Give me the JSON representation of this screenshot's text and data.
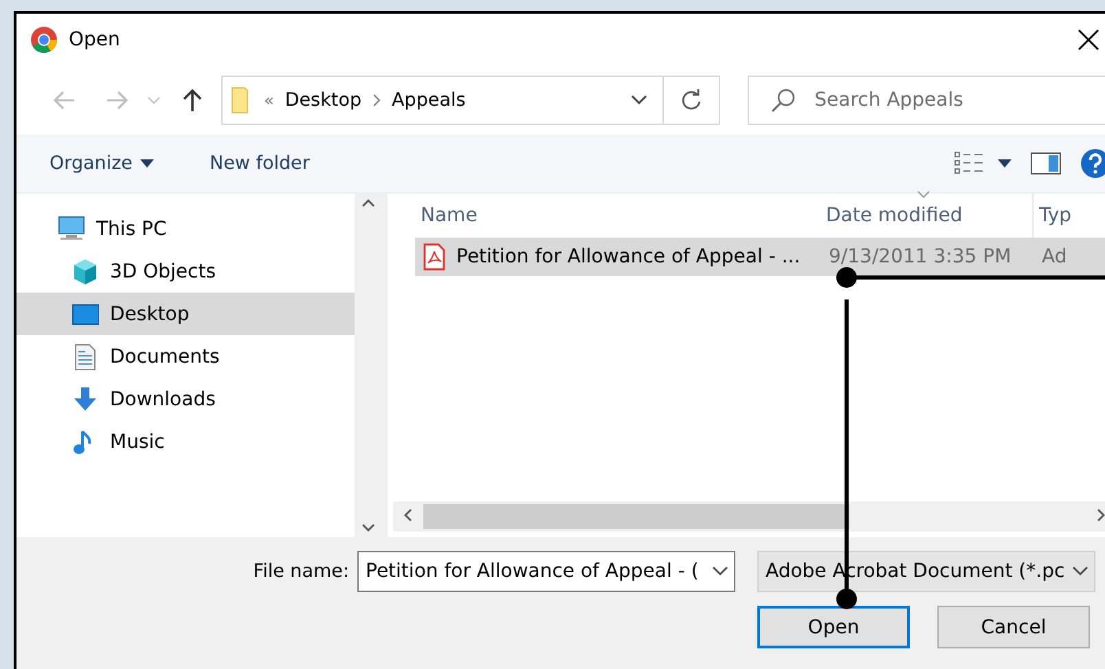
{
  "window": {
    "title": "Open"
  },
  "nav": {
    "back_disabled": true,
    "forward_disabled": true,
    "path_prefix": "«",
    "path": [
      "Desktop",
      "Appeals"
    ]
  },
  "search": {
    "placeholder": "Search Appeals"
  },
  "toolbar": {
    "organize": "Organize",
    "new_folder": "New folder"
  },
  "sidebar": {
    "items": [
      {
        "label": "This PC",
        "kind": "pc",
        "selected": false,
        "children": [
          {
            "label": "3D Objects",
            "kind": "cube",
            "selected": false
          },
          {
            "label": "Desktop",
            "kind": "desktop",
            "selected": true
          },
          {
            "label": "Documents",
            "kind": "documents",
            "selected": false
          },
          {
            "label": "Downloads",
            "kind": "downloads",
            "selected": false
          },
          {
            "label": "Music",
            "kind": "music",
            "selected": false
          }
        ]
      }
    ]
  },
  "table": {
    "columns": [
      "Name",
      "Date modified",
      "Typ"
    ],
    "rows": [
      {
        "name": "Petition for Allowance of Appeal - ...",
        "date": "9/13/2011 3:35 PM",
        "type": "Ad",
        "selected": true
      }
    ]
  },
  "file_name": {
    "label": "File name:",
    "value": "Petition for Allowance of Appeal - ("
  },
  "file_type": {
    "value": "Adobe Acrobat Document (*.pc"
  },
  "buttons": [
    {
      "label": "Open",
      "default": true
    },
    {
      "label": "Cancel",
      "default": false
    }
  ],
  "callouts": [
    {
      "kind": "horizontal"
    },
    {
      "kind": "vertical"
    }
  ]
}
